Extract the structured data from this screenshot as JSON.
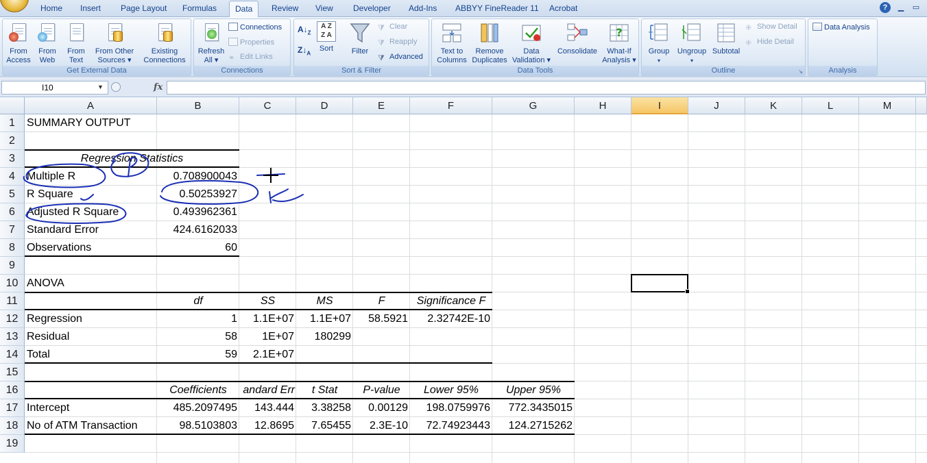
{
  "ribbon_tabs": [
    "Home",
    "Insert",
    "Page Layout",
    "Formulas",
    "Data",
    "Review",
    "View",
    "Developer",
    "Add-Ins",
    "ABBYY FineReader 11",
    "Acrobat"
  ],
  "active_tab": "Data",
  "groups": {
    "external": {
      "label": "Get External Data",
      "from_access": [
        "From",
        "Access"
      ],
      "from_web": [
        "From",
        "Web"
      ],
      "from_text": [
        "From",
        "Text"
      ],
      "from_other": [
        "From Other",
        "Sources ▾"
      ],
      "existing": [
        "Existing",
        "Connections"
      ]
    },
    "connections": {
      "label": "Connections",
      "refresh": [
        "Refresh",
        "All ▾"
      ],
      "connections": "Connections",
      "properties": "Properties",
      "edit_links": "Edit Links"
    },
    "sort_filter": {
      "label": "Sort & Filter",
      "sort": "Sort",
      "filter": "Filter",
      "clear": "Clear",
      "reapply": "Reapply",
      "advanced": "Advanced"
    },
    "data_tools": {
      "label": "Data Tools",
      "text_to_columns": [
        "Text to",
        "Columns"
      ],
      "remove_duplicates": [
        "Remove",
        "Duplicates"
      ],
      "data_validation": [
        "Data",
        "Validation ▾"
      ],
      "consolidate": "Consolidate",
      "what_if": [
        "What-If",
        "Analysis ▾"
      ]
    },
    "outline": {
      "label": "Outline",
      "group": "Group",
      "ungroup": "Ungroup",
      "subtotal": "Subtotal",
      "show_detail": "Show Detail",
      "hide_detail": "Hide Detail"
    },
    "analysis": {
      "label": "Analysis",
      "data_analysis": "Data Analysis"
    }
  },
  "formula_bar": {
    "name_box": "I10",
    "fx": "fx",
    "formula": ""
  },
  "columns": [
    "A",
    "B",
    "C",
    "D",
    "E",
    "F",
    "G",
    "H",
    "I",
    "J",
    "K",
    "L",
    "M"
  ],
  "selected_column": "I",
  "rows": [
    "1",
    "2",
    "3",
    "4",
    "5",
    "6",
    "7",
    "8",
    "9",
    "10",
    "11",
    "12",
    "13",
    "14",
    "15",
    "16",
    "17",
    "18",
    "19"
  ],
  "sheet": {
    "title": "SUMMARY OUTPUT",
    "regression_statistics_header": "Regression Statistics",
    "stats": [
      {
        "label": "Multiple R",
        "value": "0.708900043"
      },
      {
        "label": "R Square",
        "value": "0.50253927"
      },
      {
        "label": "Adjusted R Square",
        "value": "0.493962361"
      },
      {
        "label": "Standard Error",
        "value": "424.6162033"
      },
      {
        "label": "Observations",
        "value": "60"
      }
    ],
    "anova_title": "ANOVA",
    "anova_headers": [
      "df",
      "SS",
      "MS",
      "F",
      "Significance F"
    ],
    "anova_rows": [
      {
        "label": "Regression",
        "cells": [
          "1",
          "1.1E+07",
          "1.1E+07",
          "58.5921",
          "2.32742E-10"
        ]
      },
      {
        "label": "Residual",
        "cells": [
          "58",
          "1E+07",
          "180299",
          "",
          ""
        ]
      },
      {
        "label": "Total",
        "cells": [
          "59",
          "2.1E+07",
          "",
          "",
          ""
        ]
      }
    ],
    "coef_headers": [
      "Coefficients",
      "andard Err",
      "t Stat",
      "P-value",
      "Lower 95%",
      "Upper 95%"
    ],
    "coef_rows": [
      {
        "label": "Intercept",
        "cells": [
          "485.2097495",
          "143.444",
          "3.38258",
          "0.00129",
          "198.0759976",
          "772.3435015"
        ]
      },
      {
        "label": "No of ATM Transaction",
        "cells": [
          "98.5103803",
          "12.8695",
          "7.65455",
          "2.3E-10",
          "72.74923443",
          "124.2715262"
        ]
      }
    ]
  },
  "colors": {
    "ribbon_text": "#15428b",
    "ink": "#1a2fb4",
    "selected_header": "#f6c666"
  }
}
